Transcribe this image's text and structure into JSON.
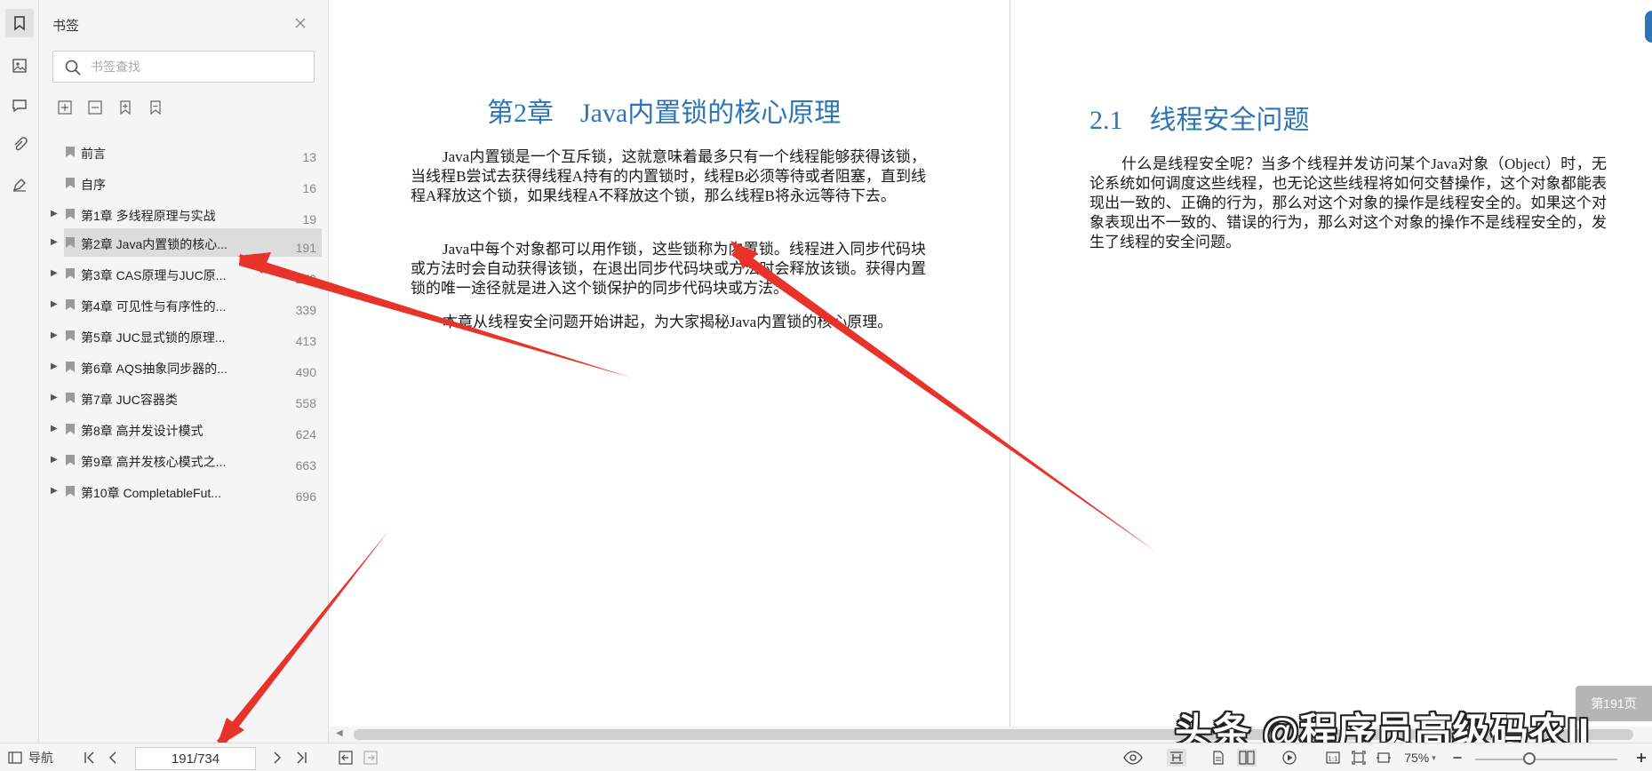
{
  "sidebar": {
    "title": "书签",
    "search_placeholder": "书签查找",
    "bookmarks": [
      {
        "label": "前言",
        "page": "13",
        "expandable": false
      },
      {
        "label": "自序",
        "page": "16",
        "expandable": false
      },
      {
        "label": "第1章 多线程原理与实战",
        "page": "19",
        "expandable": true
      },
      {
        "label": "第2章 Java内置锁的核心...",
        "page": "191",
        "expandable": true,
        "selected": true
      },
      {
        "label": "第3章 CAS原理与JUC原...",
        "page": "279",
        "expandable": true
      },
      {
        "label": "第4章 可见性与有序性的...",
        "page": "339",
        "expandable": true
      },
      {
        "label": "第5章 JUC显式锁的原理...",
        "page": "413",
        "expandable": true
      },
      {
        "label": "第6章 AQS抽象同步器的...",
        "page": "490",
        "expandable": true
      },
      {
        "label": "第7章 JUC容器类",
        "page": "558",
        "expandable": true
      },
      {
        "label": "第8章 高并发设计模式",
        "page": "624",
        "expandable": true
      },
      {
        "label": "第9章 高并发核心模式之...",
        "page": "663",
        "expandable": true
      },
      {
        "label": "第10章 CompletableFut...",
        "page": "696",
        "expandable": true
      }
    ]
  },
  "document": {
    "left_page": {
      "title": "第2章　Java内置锁的核心原理",
      "paragraphs": [
        "Java内置锁是一个互斥锁，这就意味着最多只有一个线程能够获得该锁，当线程B尝试去获得线程A持有的内置锁时，线程B必须等待或者阻塞，直到线程A释放这个锁，如果线程A不释放这个锁，那么线程B将永远等待下去。",
        "Java中每个对象都可以用作锁，这些锁称为内置锁。线程进入同步代码块或方法时会自动获得该锁，在退出同步代码块或方法时会释放该锁。获得内置锁的唯一途径就是进入这个锁保护的同步代码块或方法。",
        "本章从线程安全问题开始讲起，为大家揭秘Java内置锁的核心原理。"
      ]
    },
    "right_page": {
      "title": "2.1　线程安全问题",
      "paragraphs": [
        "什么是线程安全呢？当多个线程并发访问某个Java对象（Object）时，无论系统如何调度这些线程，也无论这些线程将如何交替操作，这个对象都能表现出一致的、正确的行为，那么对这个对象的操作是线程安全的。如果这个对象表现出不一致的、错误的行为，那么对这个对象的操作不是线程安全的，发生了线程的安全问题。"
      ]
    },
    "page_badge": "第191页",
    "watermark": "头条 @程序员高级码农II"
  },
  "statusbar": {
    "nav_label": "导航",
    "page_value": "191/734",
    "zoom": "75%"
  },
  "colors": {
    "heading": "#2e75b6",
    "arrow": "#e8332a"
  }
}
